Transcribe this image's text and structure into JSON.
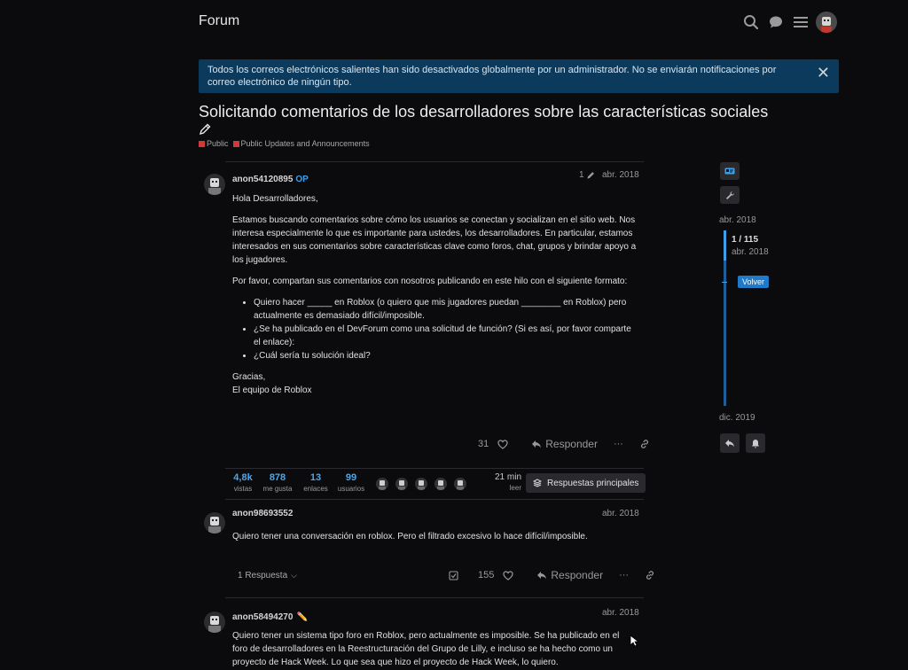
{
  "header": {
    "title": "Forum",
    "icons": [
      "search-icon",
      "chat-icon",
      "menu-icon",
      "user-avatar"
    ]
  },
  "banner": {
    "text": "Todos los correos electrónicos salientes han sido desactivados globalmente por un administrador. No se enviarán notificaciones por correo electrónico de ningún tipo.",
    "close": "✕"
  },
  "topic": {
    "title": "Solicitando comentarios de los desarrolladores sobre las características sociales",
    "categories": [
      {
        "label": "Public",
        "color": "#d23a3a"
      },
      {
        "label": "Public Updates and Announcements",
        "color": "#d23a3a"
      }
    ]
  },
  "posts": [
    {
      "username": "anon54120895",
      "op": "OP",
      "edits": "1",
      "date": "abr. 2018",
      "greeting": "Hola Desarrolladores,",
      "p1": "Estamos buscando comentarios sobre cómo los usuarios se conectan y socializan en el sitio web. Nos interesa especialmente lo que es importante para ustedes, los desarrolladores. En particular, estamos interesados en sus comentarios sobre características clave como foros, chat, grupos y brindar apoyo a los jugadores.",
      "p2": "Por favor, compartan sus comentarios con nosotros publicando en este hilo con el siguiente formato:",
      "bullets": [
        "Quiero hacer _____ en Roblox (o quiero que mis jugadores puedan ________ en Roblox) pero actualmente es demasiado difícil/imposible.",
        "¿Se ha publicado en el DevForum como una solicitud de función? (Si es así, por favor comparte el enlace):",
        "¿Cuál sería tu solución ideal?"
      ],
      "closing1": "Gracias,",
      "closing2": "El equipo de Roblox",
      "likes": "31",
      "reply_label": "Responder"
    },
    {
      "username": "anon98693552",
      "date": "abr. 2018",
      "text": "Quiero tener una conversación en roblox. Pero el filtrado excesivo lo hace difícil/imposible.",
      "replies_label": "1 Respuesta",
      "likes": "155",
      "reply_label": "Responder"
    },
    {
      "username": "anon58494270",
      "flair": "✏️",
      "date": "abr. 2018",
      "text": "Quiero tener un sistema tipo foro en Roblox, pero actualmente es imposible. Se ha publicado en el foro de desarrolladores en la Reestructuración del Grupo de Lilly, e incluso se ha hecho como un proyecto de Hack Week. Lo que sea que hizo el proyecto de Hack Week, lo quiero."
    }
  ],
  "stats": {
    "views": {
      "num": "4,8k",
      "label": "vistas"
    },
    "likes": {
      "num": "878",
      "label": "me gusta"
    },
    "links": {
      "num": "13",
      "label": "enlaces"
    },
    "users": {
      "num": "99",
      "label": "usuarios"
    },
    "read_time": "21 min",
    "read_label": "leer",
    "top_replies": "Respuestas principales"
  },
  "timeline": {
    "start_date": "abr. 2018",
    "position": "1 / 115",
    "position_date": "abr. 2018",
    "back_label": "Volver",
    "end_date": "dic. 2019"
  }
}
